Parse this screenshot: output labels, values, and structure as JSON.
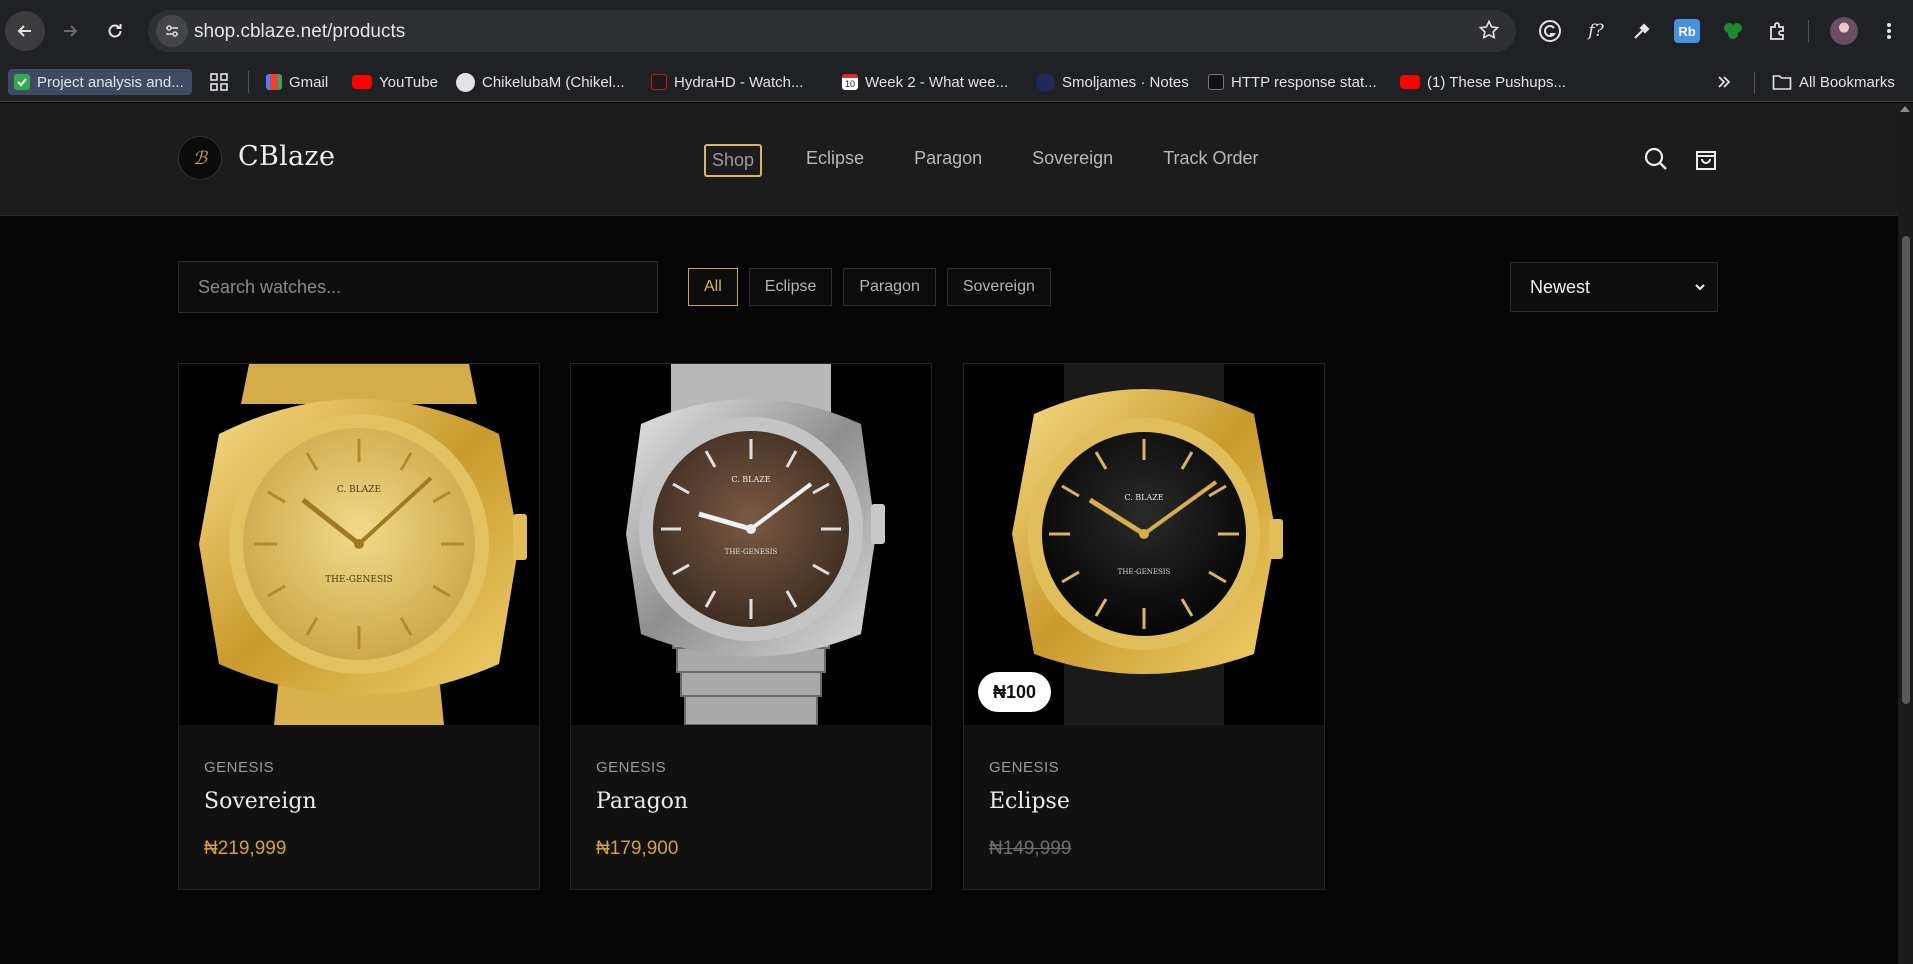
{
  "browser": {
    "url": "shop.cblaze.net/products",
    "bookmarks": [
      {
        "label": "Project analysis and...",
        "color": "#34a853"
      },
      {
        "label": "Gmail",
        "color": "#ea4335"
      },
      {
        "label": "YouTube",
        "color": "#ff0000"
      },
      {
        "label": "ChikelubaM (Chikel...",
        "color": "#e3e3e3"
      },
      {
        "label": "HydraHD - Watch...",
        "color": "#c4161c"
      },
      {
        "label": "Week 2 - What wee...",
        "color": "#e8e8e8"
      },
      {
        "label": "Smoljames · Notes",
        "color": "#1e2a5a"
      },
      {
        "label": "HTTP response stat...",
        "color": "#111111"
      },
      {
        "label": "(1) These Pushups...",
        "color": "#ff0000"
      }
    ],
    "all_bookmarks_label": "All Bookmarks",
    "ext_f_label": "f?",
    "ext_rb_label": "Rb",
    "calendar_day": "10"
  },
  "site": {
    "brand": "CBlaze",
    "logo_glyph": "ℬ",
    "nav": [
      {
        "label": "Shop"
      },
      {
        "label": "Eclipse"
      },
      {
        "label": "Paragon"
      },
      {
        "label": "Sovereign"
      },
      {
        "label": "Track Order"
      }
    ]
  },
  "filters": {
    "search_placeholder": "Search watches...",
    "chips": [
      "All",
      "Eclipse",
      "Paragon",
      "Sovereign"
    ],
    "active_chip": "All",
    "sort_value": "Newest"
  },
  "products": [
    {
      "category": "GENESIS",
      "name": "Sovereign",
      "price": "₦219,999",
      "badge": "",
      "dial_text": "THE-GENESIS",
      "brand_mark": "C. BLAZE",
      "case": "gold",
      "dial": "gold"
    },
    {
      "category": "GENESIS",
      "name": "Paragon",
      "price": "₦179,900",
      "badge": "",
      "dial_text": "THE-GENESIS",
      "brand_mark": "C. BLAZE",
      "case": "silver",
      "dial": "brown"
    },
    {
      "category": "GENESIS",
      "name": "Eclipse",
      "price": "₦149,999",
      "badge": "₦100",
      "dial_text": "THE-GENESIS",
      "brand_mark": "C. BLAZE",
      "case": "gold",
      "dial": "black"
    }
  ],
  "colors": {
    "accent_gold": "#d4a13c",
    "page_bg": "#050505",
    "header_bg": "#1c1c1c"
  }
}
